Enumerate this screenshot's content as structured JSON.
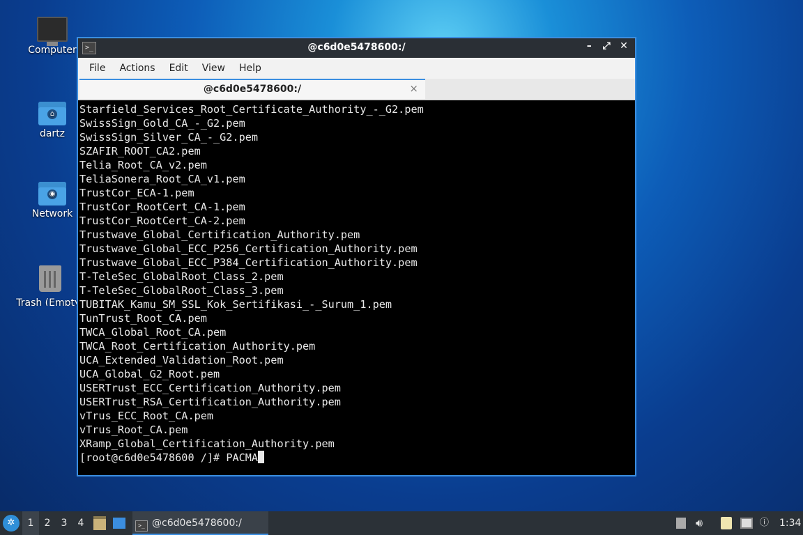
{
  "desktop": {
    "icons": [
      {
        "label": "Computer"
      },
      {
        "label": "dartz"
      },
      {
        "label": "Network"
      },
      {
        "label": "Trash (Empty)"
      }
    ]
  },
  "window": {
    "title": "@c6d0e5478600:/",
    "controls": {
      "minimize": "–",
      "maximize": "⤢",
      "close": "✕"
    },
    "menu": [
      "File",
      "Actions",
      "Edit",
      "View",
      "Help"
    ],
    "tab": {
      "label": "@c6d0e5478600:/",
      "close": "×"
    },
    "terminal_lines": [
      "Starfield_Services_Root_Certificate_Authority_-_G2.pem",
      "SwissSign_Gold_CA_-_G2.pem",
      "SwissSign_Silver_CA_-_G2.pem",
      "SZAFIR_ROOT_CA2.pem",
      "Telia_Root_CA_v2.pem",
      "TeliaSonera_Root_CA_v1.pem",
      "TrustCor_ECA-1.pem",
      "TrustCor_RootCert_CA-1.pem",
      "TrustCor_RootCert_CA-2.pem",
      "Trustwave_Global_Certification_Authority.pem",
      "Trustwave_Global_ECC_P256_Certification_Authority.pem",
      "Trustwave_Global_ECC_P384_Certification_Authority.pem",
      "T-TeleSec_GlobalRoot_Class_2.pem",
      "T-TeleSec_GlobalRoot_Class_3.pem",
      "TUBITAK_Kamu_SM_SSL_Kok_Sertifikasi_-_Surum_1.pem",
      "TunTrust_Root_CA.pem",
      "TWCA_Global_Root_CA.pem",
      "TWCA_Root_Certification_Authority.pem",
      "UCA_Extended_Validation_Root.pem",
      "UCA_Global_G2_Root.pem",
      "USERTrust_ECC_Certification_Authority.pem",
      "USERTrust_RSA_Certification_Authority.pem",
      "vTrus_ECC_Root_CA.pem",
      "vTrus_Root_CA.pem",
      "XRamp_Global_Certification_Authority.pem"
    ],
    "prompt": "[root@c6d0e5478600 /]# ",
    "input": "PACMA"
  },
  "taskbar": {
    "workspaces": [
      "1",
      "2",
      "3",
      "4"
    ],
    "active_workspace": "1",
    "task_label": "@c6d0e5478600:/",
    "clock": "1:34"
  }
}
